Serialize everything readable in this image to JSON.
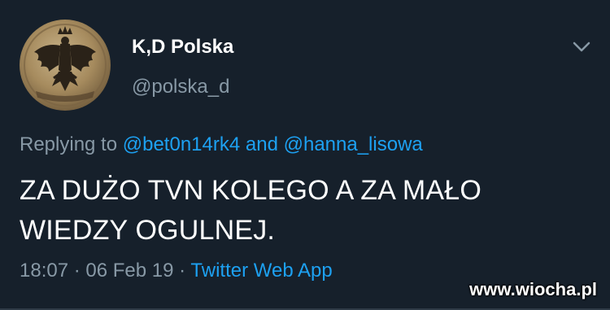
{
  "author": {
    "display_name": "K,D Polska",
    "handle": "@polska_d",
    "avatar_icon": "polish-eagle-emblem"
  },
  "reply": {
    "prefix": "Replying to",
    "mention_1": "@bet0n14rk4",
    "conjunction": "and",
    "mention_2": "@hanna_lisowa"
  },
  "tweet": {
    "line_1": "ZA DUŻO TVN KOLEGO A ZA MAŁO",
    "line_2": "WIEDZY OGULNEJ."
  },
  "meta": {
    "time": "18:07",
    "separator": "·",
    "date": "06 Feb 19",
    "source": "Twitter Web App"
  },
  "watermark": "www.wiocha.pl",
  "colors": {
    "background": "#16202b",
    "text": "#ffffff",
    "muted": "#8899a6",
    "link": "#1da1f2"
  }
}
